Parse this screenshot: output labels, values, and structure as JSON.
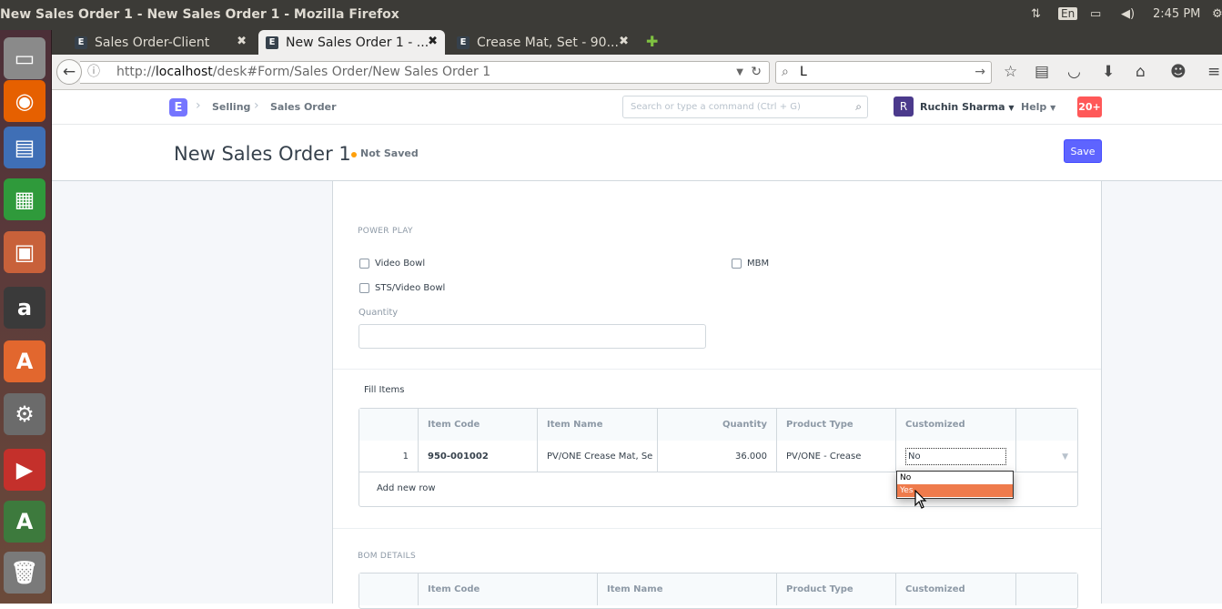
{
  "os": {
    "window_title": "New Sales Order 1 - New Sales Order 1 - Mozilla Firefox",
    "keyboard_layout": "En",
    "clock": "2:45 PM"
  },
  "launcher": {
    "items": [
      {
        "name": "files-icon",
        "color": "#8a8a8a",
        "glyph": "▭"
      },
      {
        "name": "firefox-icon",
        "color": "#e66000",
        "glyph": "◉"
      },
      {
        "name": "writer-icon",
        "color": "#3f6fb6",
        "glyph": "▤"
      },
      {
        "name": "calc-icon",
        "color": "#2f9a3b",
        "glyph": "▦"
      },
      {
        "name": "impress-icon",
        "color": "#c8613a",
        "glyph": "▣"
      },
      {
        "name": "amazon-icon",
        "color": "#3a3a3a",
        "glyph": "a"
      },
      {
        "name": "software-center-icon",
        "color": "#e2672e",
        "glyph": "A"
      },
      {
        "name": "settings-icon",
        "color": "#6b6b6b",
        "glyph": "⚙"
      },
      {
        "name": "youtube-icon",
        "color": "#c4302b",
        "glyph": "▶"
      },
      {
        "name": "update-manager-icon",
        "color": "#3d7a3d",
        "glyph": "A"
      },
      {
        "name": "trash-icon",
        "color": "#7a7a7a",
        "glyph": "🗑"
      }
    ]
  },
  "browser": {
    "tabs": [
      {
        "label": "Sales Order-Client",
        "favicon": "E",
        "active": false
      },
      {
        "label": "New Sales Order 1 - ...",
        "favicon": "E",
        "active": true
      },
      {
        "label": "Crease Mat, Set - 90...",
        "favicon": "E",
        "active": false
      }
    ],
    "new_tab": "✚",
    "url_prefix": "http://",
    "url_host": "localhost",
    "url_path": "/desk#Form/Sales Order/New Sales Order 1",
    "search_value": "L"
  },
  "app": {
    "logo": "E",
    "breadcrumbs": [
      "Selling",
      "Sales Order"
    ],
    "search_placeholder": "Search or type a command (Ctrl + G)",
    "user_initial": "R",
    "user_name": "Ruchin Sharma",
    "help_label": "Help",
    "notifications": "20+"
  },
  "page": {
    "title": "New Sales Order 1",
    "status": "Not Saved",
    "save_label": "Save"
  },
  "form": {
    "power_play": {
      "heading": "POWER PLAY",
      "checkboxes": [
        "Video Bowl",
        "MBM",
        "STS/Video Bowl"
      ],
      "quantity_label": "Quantity",
      "quantity_value": ""
    },
    "fill_items": {
      "label": "Fill Items",
      "columns": [
        "",
        "Item Code",
        "Item Name",
        "Quantity",
        "Product Type",
        "Customized",
        ""
      ],
      "rows": [
        {
          "idx": "1",
          "item_code": "950-001002",
          "item_name": "PV/ONE Crease Mat, Se",
          "quantity": "36.000",
          "product_type": "PV/ONE - Crease",
          "customized": "No"
        }
      ],
      "add_row": "Add new row",
      "dropdown_options": [
        "No",
        "Yes"
      ],
      "highlighted_option": "Yes"
    },
    "bom_details": {
      "heading": "BOM DETAILS",
      "columns": [
        "",
        "Item Code",
        "Item Name",
        "Product Type",
        "Customized",
        ""
      ]
    }
  }
}
